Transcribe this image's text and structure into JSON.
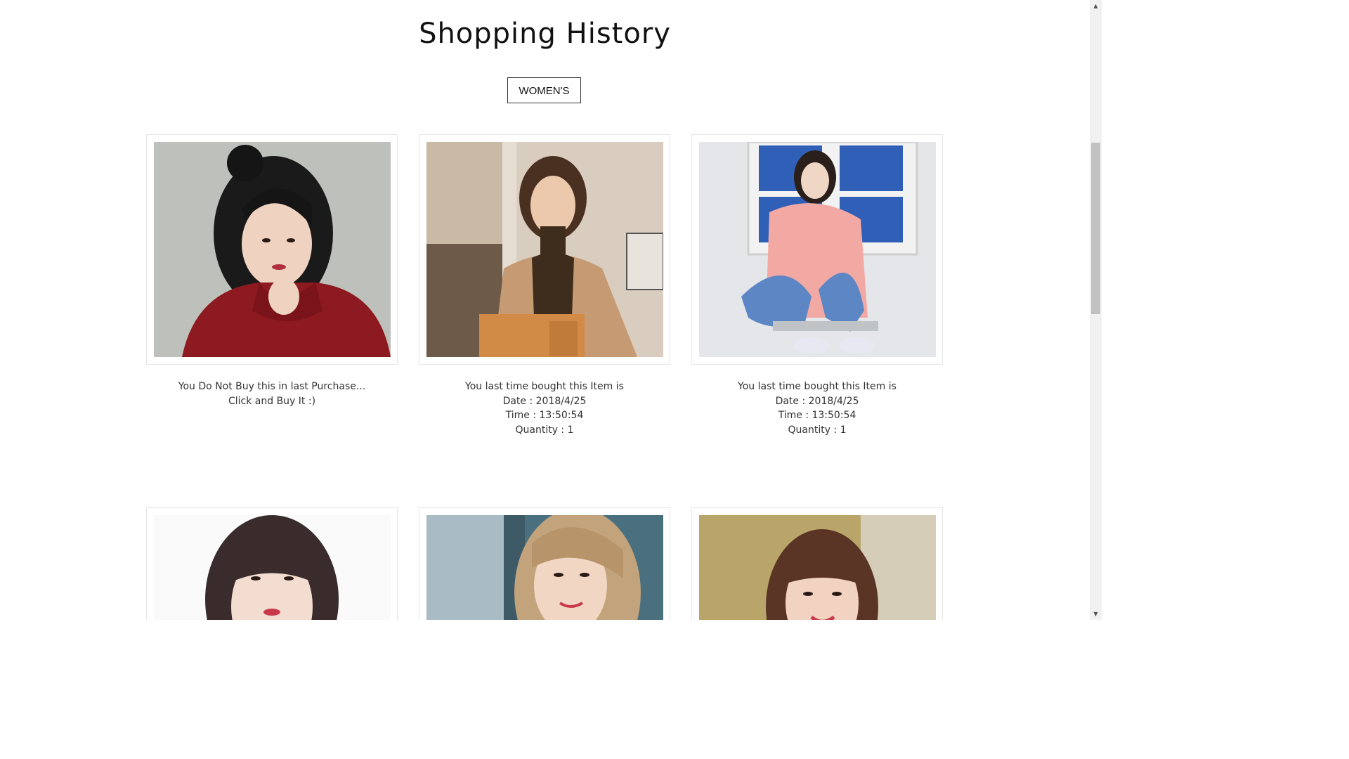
{
  "page": {
    "title": "Shopping History",
    "filter_label": "WOMEN'S"
  },
  "items": [
    {
      "photo": "woman-red-sweater-photo",
      "lines": [
        "You Do Not Buy this in last Purchase...",
        "Click and Buy It :)"
      ]
    },
    {
      "photo": "woman-camel-coat-photo",
      "lines": [
        "You last time bought this Item is",
        "Date : 2018/4/25",
        "Time : 13:50:54",
        "Quantity : 1"
      ]
    },
    {
      "photo": "woman-pink-jacket-photo",
      "lines": [
        "You last time bought this Item is",
        "Date : 2018/4/25",
        "Time : 13:50:54",
        "Quantity : 1"
      ]
    },
    {
      "photo": "woman-white-top-photo",
      "lines": []
    },
    {
      "photo": "woman-blonde-outdoor-photo",
      "lines": []
    },
    {
      "photo": "woman-bangs-smiling-photo",
      "lines": []
    }
  ],
  "colors": {
    "text": "#333333",
    "border": "#e6e6e6",
    "scrollbar_track": "#f1f1f1",
    "scrollbar_thumb": "#c1c1c1"
  },
  "icons": {
    "scroll_up": "triangle-up-icon",
    "scroll_down": "triangle-down-icon"
  }
}
